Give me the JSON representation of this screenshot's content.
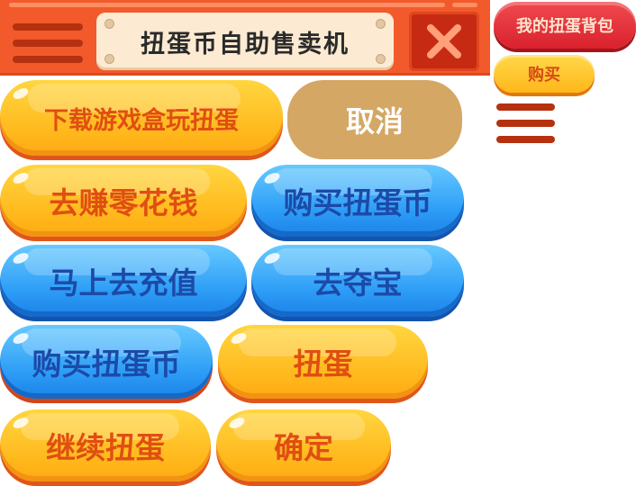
{
  "header": {
    "title": "扭蛋币自助售卖机"
  },
  "side": {
    "bag_label": "我的扭蛋背包",
    "buy_label": "购买"
  },
  "buttons": {
    "download": "下载游戏盒玩扭蛋",
    "cancel": "取消",
    "earn_money": "去赚零花钱",
    "buy_coins_1": "购买扭蛋币",
    "recharge": "马上去充值",
    "treasure": "去夺宝",
    "buy_coins_2": "购买扭蛋币",
    "gacha": "扭蛋",
    "continue_gacha": "继续扭蛋",
    "confirm": "确定"
  },
  "colors": {
    "header_bg": "#f25a2c",
    "yellow_button": "#ffb81c",
    "blue_button": "#2c9cf6",
    "tan_button": "#d4a764",
    "red_button": "#d9212d"
  },
  "icons": {
    "menu": "hamburger-menu-icon",
    "close": "close-icon"
  }
}
